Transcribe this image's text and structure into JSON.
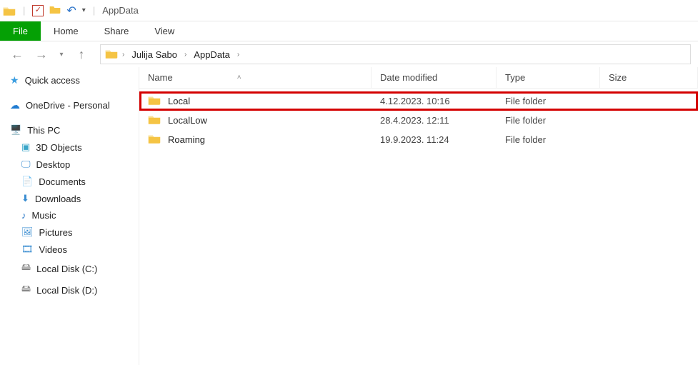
{
  "titlebar": {
    "title": "AppData"
  },
  "ribbon": {
    "file": "File",
    "home": "Home",
    "share": "Share",
    "view": "View"
  },
  "breadcrumb": {
    "items": [
      "Julija Sabo",
      "AppData"
    ]
  },
  "sidebar": {
    "quick_access": "Quick access",
    "onedrive": "OneDrive - Personal",
    "this_pc": "This PC",
    "objects3d": "3D Objects",
    "desktop": "Desktop",
    "documents": "Documents",
    "downloads": "Downloads",
    "music": "Music",
    "pictures": "Pictures",
    "videos": "Videos",
    "local_disk_c": "Local Disk (C:)",
    "local_disk_d": "Local Disk (D:)"
  },
  "columns": {
    "name": "Name",
    "date_modified": "Date modified",
    "type": "Type",
    "size": "Size"
  },
  "rows": [
    {
      "name": "Local",
      "date": "4.12.2023. 10:16",
      "type": "File folder",
      "size": "",
      "highlighted": true
    },
    {
      "name": "LocalLow",
      "date": "28.4.2023. 12:11",
      "type": "File folder",
      "size": "",
      "highlighted": false
    },
    {
      "name": "Roaming",
      "date": "19.9.2023. 11:24",
      "type": "File folder",
      "size": "",
      "highlighted": false
    }
  ]
}
